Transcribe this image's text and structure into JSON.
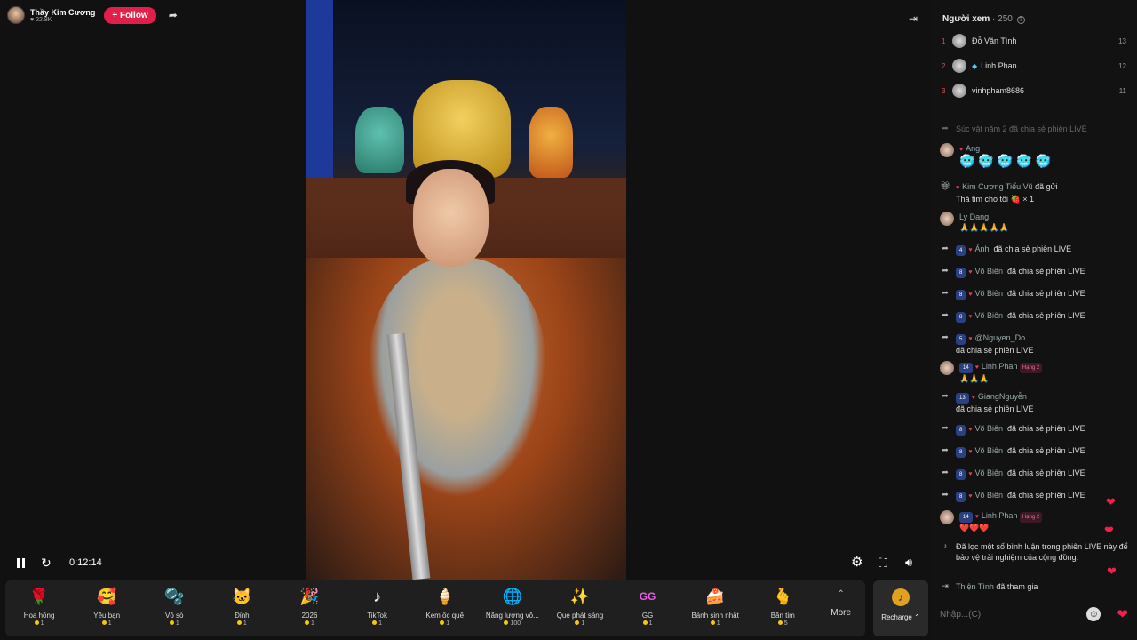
{
  "streamer": {
    "name": "Thầy Kim Cương",
    "likes": "♥ 22.8K",
    "follow_label": "+ Follow"
  },
  "player": {
    "time": "0:12:14"
  },
  "gifts": [
    {
      "name": "Hoa hồng",
      "price": "1",
      "icon": "🌹"
    },
    {
      "name": "Yêu bạn",
      "price": "1",
      "icon": "🥰"
    },
    {
      "name": "Vỗ sò",
      "price": "1",
      "icon": "🫧"
    },
    {
      "name": "Đỉnh",
      "price": "1",
      "icon": "🐱"
    },
    {
      "name": "2026",
      "price": "1",
      "icon": "🎉"
    },
    {
      "name": "TikTok",
      "price": "1",
      "icon": "♪"
    },
    {
      "name": "Kem ốc quế",
      "price": "1",
      "icon": "🍦"
    },
    {
      "name": "Năng lượng vô...",
      "price": "100",
      "icon": "🌐"
    },
    {
      "name": "Que phát sáng",
      "price": "1",
      "icon": "✨"
    },
    {
      "name": "GG",
      "price": "1",
      "icon": "GG"
    },
    {
      "name": "Bánh sinh nhật",
      "price": "1",
      "icon": "🍰"
    },
    {
      "name": "Bắn tim",
      "price": "5",
      "icon": "🫰"
    }
  ],
  "more_label": "More",
  "recharge_label": "Recharge ⌃",
  "viewers": {
    "title": "Người xem",
    "count": "· 250",
    "list": [
      {
        "rank": "1",
        "name": "Đỗ Văn Tình",
        "score": "13"
      },
      {
        "rank": "2",
        "name": "Linh Phan",
        "score": "12"
      },
      {
        "rank": "3",
        "name": "vinhpham8686",
        "score": "11"
      }
    ]
  },
  "chat": {
    "faded": "Súc vật năm 2  đã chia sẻ phiên LIVE",
    "ang_name": "Ang",
    "ang_emojis": "🥶🥶🥶🥶🥶",
    "gift_user": "Kim Cương Tiểu Vũ",
    "gift_action": "đã gửi",
    "gift_text": "Thả tim cho tôi 🍓 × 1",
    "ly_name": "Ly Dang",
    "ly_emojis": "🙏🙏🙏🙏🙏",
    "shares": [
      {
        "lvl": "4",
        "name": "Ảnh",
        "text": "đã chia sẻ phiên LIVE"
      },
      {
        "lvl": "8",
        "name": "Võ Biên",
        "text": "đã chia sẻ phiên LIVE"
      },
      {
        "lvl": "8",
        "name": "Võ Biên",
        "text": "đã chia sẻ phiên LIVE"
      },
      {
        "lvl": "8",
        "name": "Võ Biên",
        "text": "đã chia sẻ phiên LIVE"
      }
    ],
    "nguyen_lvl": "5",
    "nguyen_name": "@Nguyen_Do",
    "nguyen_text": "đã chia sẻ phiên LIVE",
    "linh1_lvl": "14",
    "linh1_name": "Linh Phan",
    "linh_rank": "Hạng 2",
    "linh1_text": "🙏🙏🙏",
    "giang_lvl": "13",
    "giang_name": "GiangNguyễn",
    "giang_text": "đã chia sẻ phiên LIVE",
    "shares2": [
      {
        "lvl": "8",
        "name": "Võ Biên",
        "text": "đã chia sẻ phiên LIVE"
      },
      {
        "lvl": "8",
        "name": "Võ Biên",
        "text": "đã chia sẻ phiên LIVE"
      },
      {
        "lvl": "8",
        "name": "Võ Biên",
        "text": "đã chia sẻ phiên LIVE"
      },
      {
        "lvl": "8",
        "name": "Võ Biên",
        "text": "đã chia sẻ phiên LIVE"
      }
    ],
    "linh2_lvl": "14",
    "linh2_name": "Linh Phan",
    "linh2_text": "❤️❤️❤️",
    "notice": "Đã lọc một số bình luận trong phiên LIVE này để bảo vệ trải nghiệm của cộng đồng.",
    "join_name": "Thiện Tình",
    "join_text": "đã tham gia"
  },
  "input": {
    "placeholder": "Nhập...(C)"
  }
}
